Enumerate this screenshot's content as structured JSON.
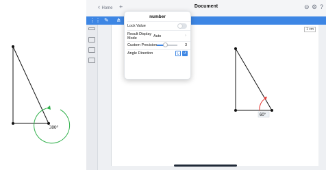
{
  "left_figure": {
    "angle_label": "300°"
  },
  "window": {
    "home_label": "Home",
    "title": "Document"
  },
  "popover": {
    "title": "number",
    "lock_value_label": "Lock Value",
    "lock_value_on": false,
    "result_mode_label_1": "Result Display",
    "result_mode_label_2": "Mode",
    "result_mode_value": "Auto",
    "precision_label": "Custom Precision",
    "precision_value": "3",
    "angle_direction_label": "Angle Direction"
  },
  "canvas": {
    "angle_label": "60°",
    "ruler_label": "1 cm"
  },
  "colors": {
    "toolbar": "#3d86e4",
    "left_arc": "#2fb04a",
    "right_arc": "#e53935"
  },
  "icons": {
    "back": "chevron-left-icon",
    "add": "plus-icon",
    "settings": "gear-icon",
    "help": "question-icon",
    "wrench": "wrench-icon"
  }
}
